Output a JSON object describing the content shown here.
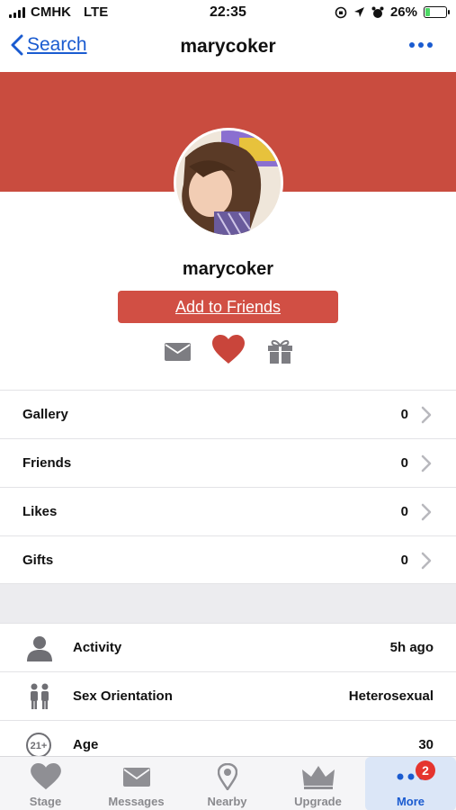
{
  "status_bar": {
    "carrier": "CMHK",
    "network": "LTE",
    "time": "22:35",
    "battery": "26%",
    "battery_level": 0.26
  },
  "nav": {
    "back_label": "Search",
    "title": "marycoker",
    "icons": [
      "chevron-left-icon",
      "more-dots-icon"
    ]
  },
  "colors": {
    "accent": "#1a5bd0",
    "banner": "#c94c3f",
    "button": "#d14f44",
    "heart": "#c9453b",
    "badge": "#e5342e"
  },
  "profile": {
    "username": "marycoker",
    "add_friend_label": "Add to Friends",
    "action_icons": [
      "message-icon",
      "heart-icon",
      "gift-icon"
    ]
  },
  "stats": [
    {
      "label": "Gallery",
      "value": "0"
    },
    {
      "label": "Friends",
      "value": "0"
    },
    {
      "label": "Likes",
      "value": "0"
    },
    {
      "label": "Gifts",
      "value": "0"
    }
  ],
  "info": [
    {
      "icon": "person-icon",
      "label": "Activity",
      "value": "5h ago"
    },
    {
      "icon": "couple-icon",
      "label": "Sex Orientation",
      "value": "Heterosexual"
    },
    {
      "icon": "age-21-icon",
      "icon_text": "21+",
      "label": "Age",
      "value": "30"
    }
  ],
  "tabbar": {
    "tabs": [
      {
        "label": "Stage",
        "icon": "heart-icon"
      },
      {
        "label": "Messages",
        "icon": "envelope-icon"
      },
      {
        "label": "Nearby",
        "icon": "location-pin-icon"
      },
      {
        "label": "Upgrade",
        "icon": "crown-icon"
      },
      {
        "label": "More",
        "icon": "more-dots-icon",
        "active": true,
        "badge": "2"
      }
    ]
  }
}
